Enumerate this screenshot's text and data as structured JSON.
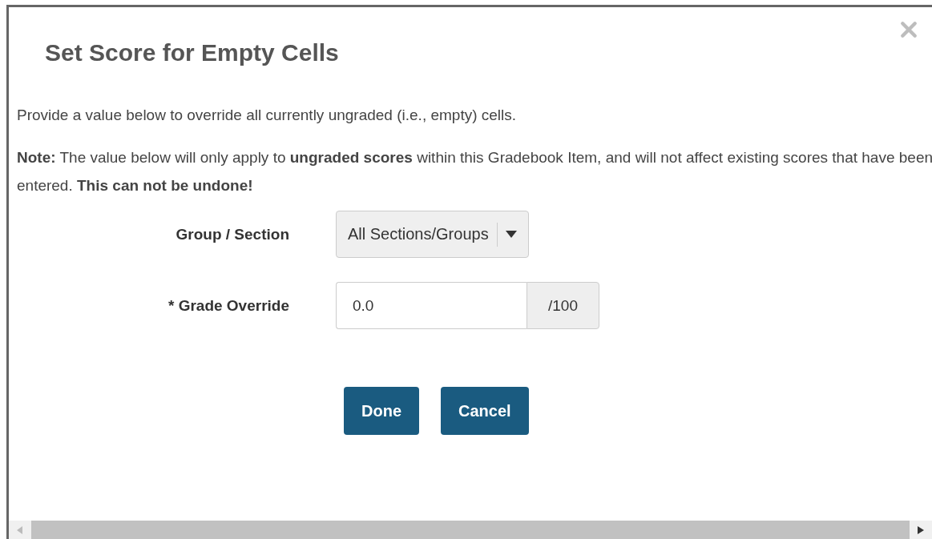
{
  "dialog": {
    "title": "Set Score for Empty Cells",
    "intro": "Provide a value below to override all currently ungraded (i.e., empty) cells.",
    "note": "**Note:** The value below will only apply to **ungraded scores** within this Gradebook Item, and will not affect existing scores that have been entered. **This can not be undone!**",
    "fields": [
      {
        "kind": "select",
        "label": "Group / Section",
        "value": "All Sections/Groups"
      },
      {
        "kind": "input",
        "label": "* Grade Override",
        "value": "0.0",
        "suffix": "/100"
      }
    ],
    "buttons": [
      "Done",
      "Cancel"
    ]
  }
}
